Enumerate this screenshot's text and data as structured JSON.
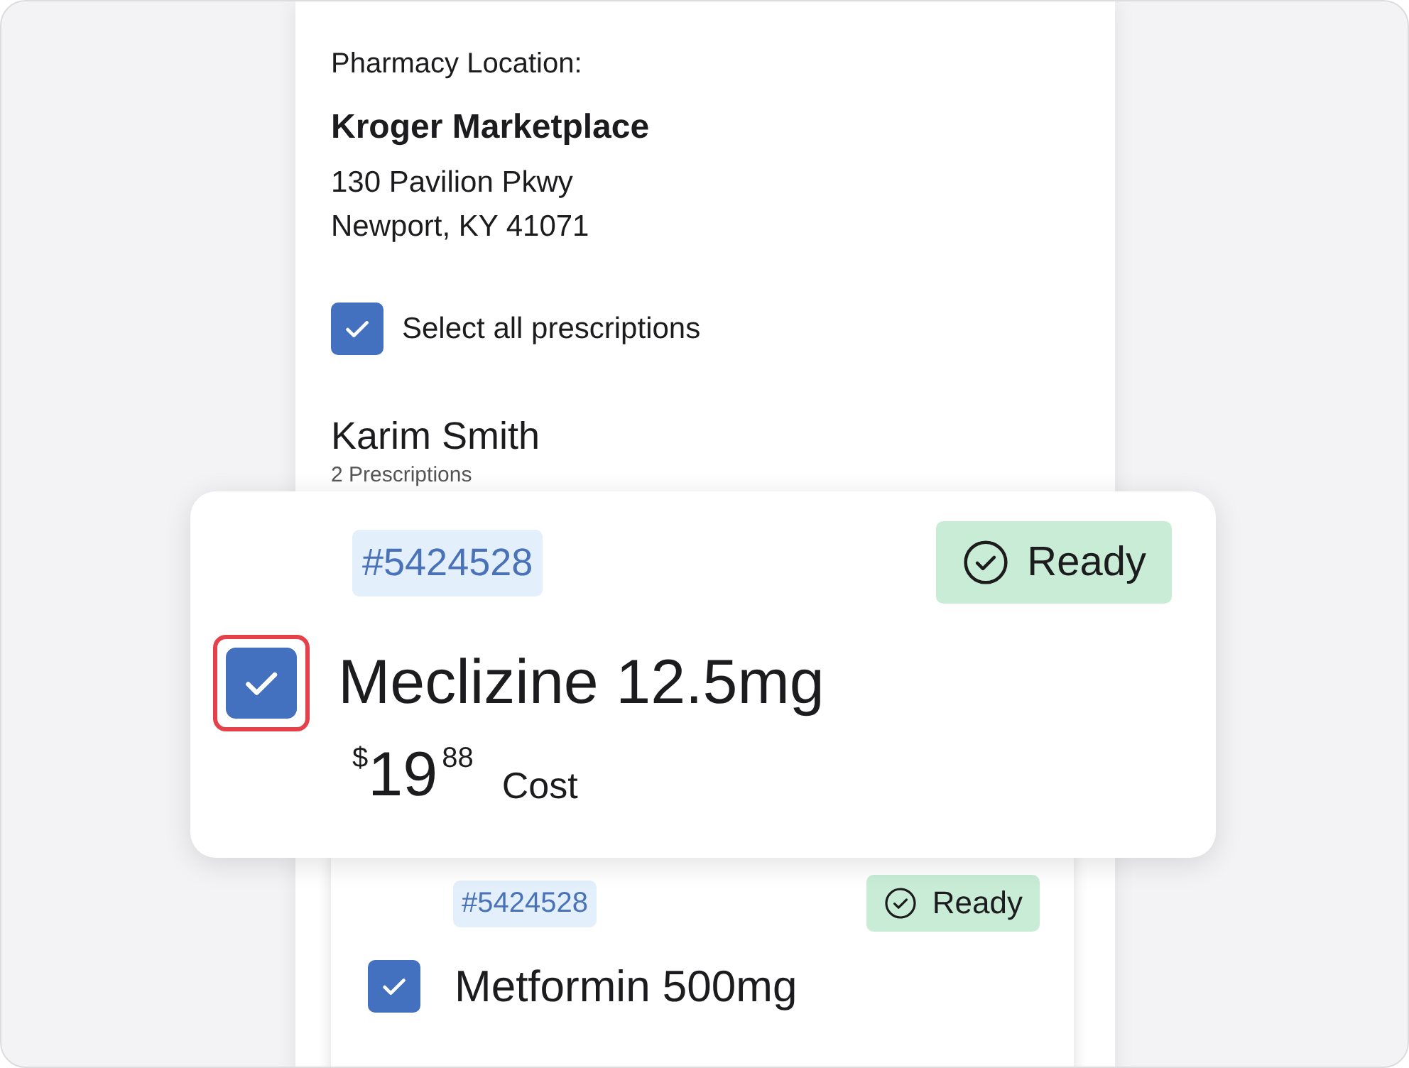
{
  "pharmacy": {
    "label": "Pharmacy Location:",
    "name": "Kroger Marketplace",
    "address_lines": [
      "130 Pavilion Pkwy",
      "Newport, KY 41071"
    ]
  },
  "select_all": {
    "label": "Select all prescriptions",
    "checked": true
  },
  "patient": {
    "name": "Karim Smith",
    "count": "2 Prescriptions"
  },
  "magnified_card": {
    "rx_number": "#5424528",
    "status": "Ready",
    "name": "Meclizine 12.5mg",
    "checked": true,
    "highlighted": true,
    "currency": "$",
    "dollars": "19",
    "cents": "88",
    "price_label": "Cost"
  },
  "prescriptions": [
    {
      "rx_number": "#5424528",
      "status": "Ready",
      "name": "Metformin 500mg",
      "checked": true
    }
  ]
}
